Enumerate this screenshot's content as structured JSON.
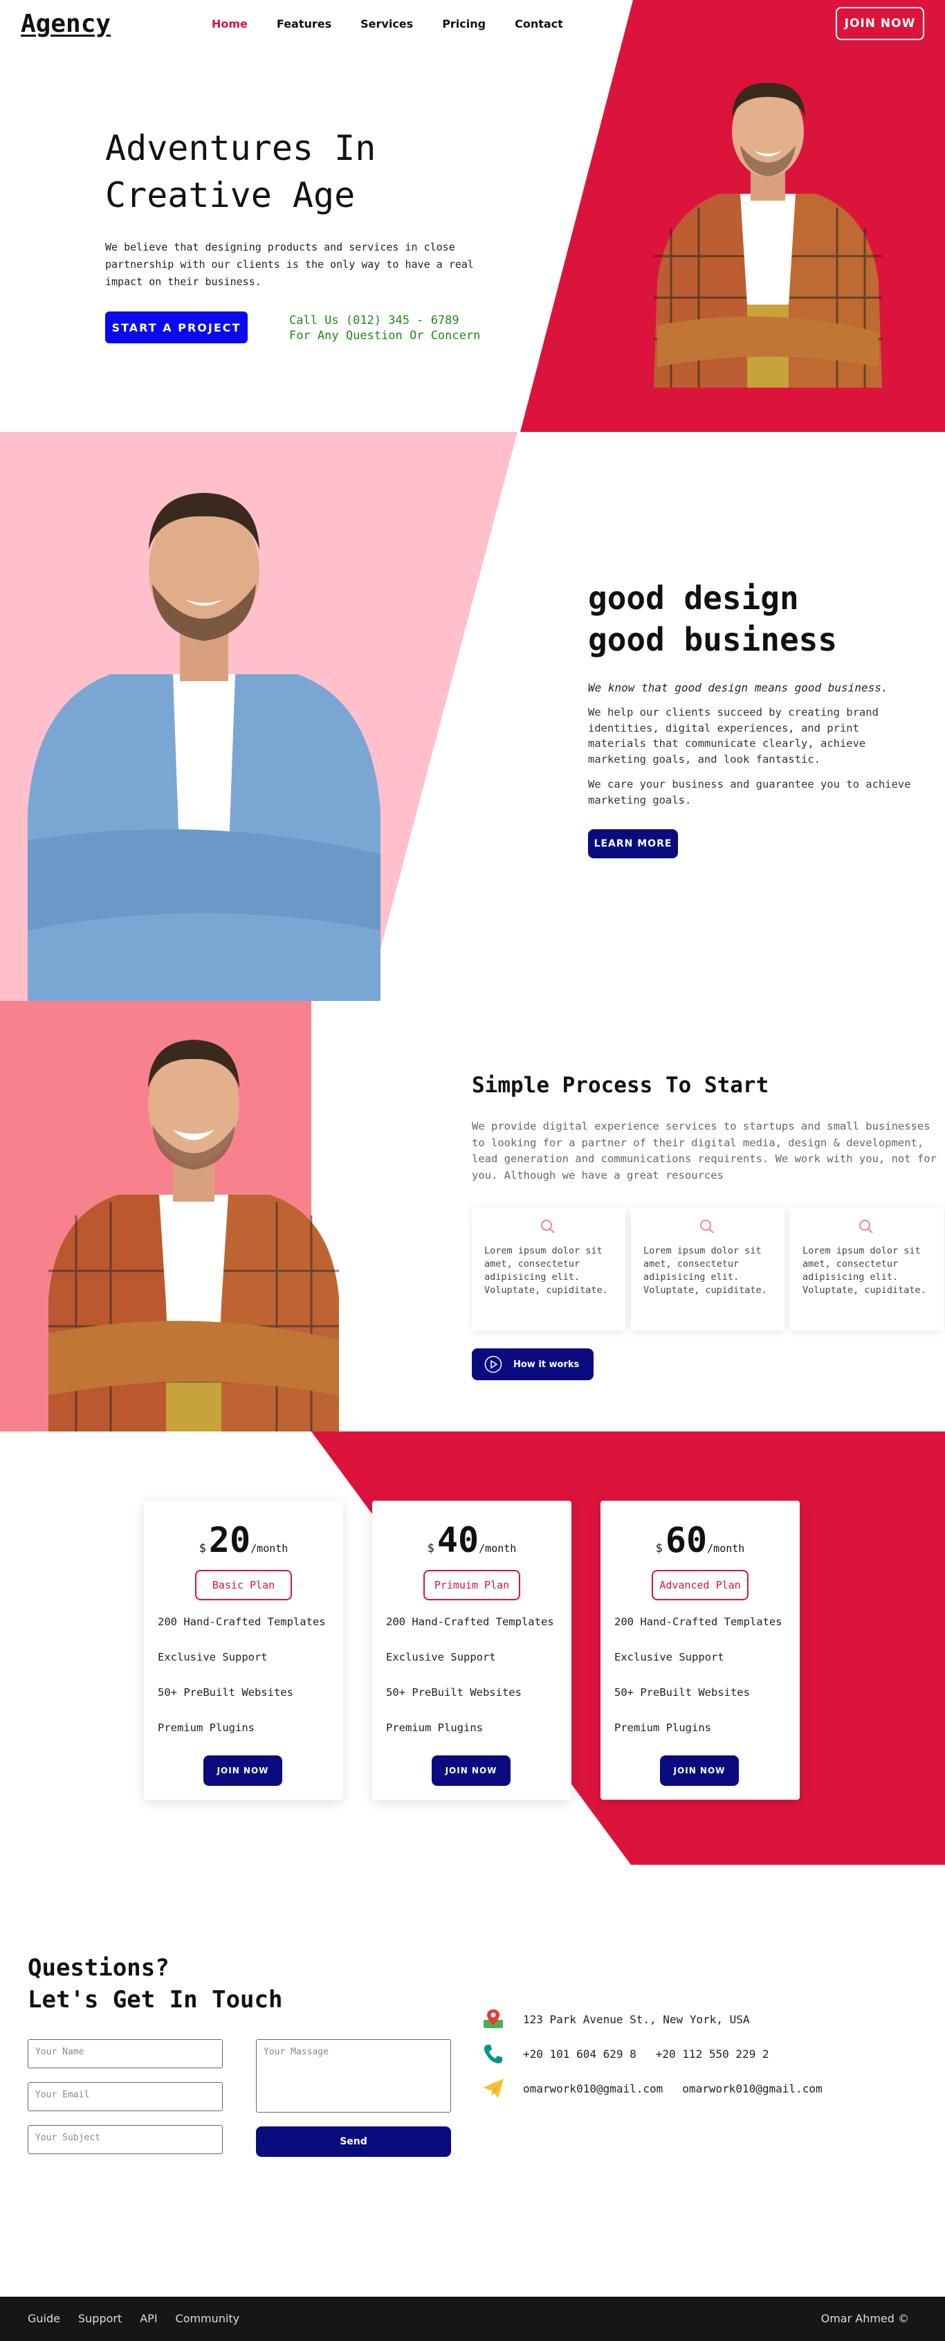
{
  "nav": {
    "logo": "Agency",
    "links": [
      "Home",
      "Features",
      "Services",
      "Pricing",
      "Contact"
    ],
    "join": "JOIN NOW"
  },
  "hero": {
    "title_line1": "Adventures In",
    "title_line2": "Creative Age",
    "text": "We believe that designing products and services in close partnership with our clients is the only way to have a real impact on their business.",
    "cta": "START A PROJECT",
    "call": "Call Us (012) 345 - 6789",
    "question": "For Any Question Or Concern"
  },
  "design": {
    "line1_bold": "good",
    "line1_rest": " design",
    "line2_bold": "good",
    "line2_rest": " business",
    "lead": "We know that good design means good business.",
    "p1": "We help our clients succeed by creating brand identities, digital experiences, and print materials that communicate clearly, achieve marketing goals, and look fantastic.",
    "p2": "We care your business and guarantee you to achieve marketing goals.",
    "cta": "LEARN MORE"
  },
  "process": {
    "title": "Simple Process To Start",
    "text": "We provide digital experience services to startups and small businesses to looking for a partner of their digital media, design & development, lead generation and communications requirents. We work with you, not for you. Although we have a great resources",
    "cards": [
      "Lorem ipsum dolor sit amet, consectetur adipisicing elit. Voluptate, cupiditate.",
      "Lorem ipsum dolor sit amet, consectetur adipisicing elit. Voluptate, cupiditate.",
      "Lorem ipsum dolor sit amet, consectetur adipisicing elit. Voluptate, cupiditate."
    ],
    "cta": "How it works"
  },
  "pricing": {
    "currency": "$",
    "period": "/month",
    "plans": [
      {
        "price": "20",
        "name": "Basic Plan"
      },
      {
        "price": "40",
        "name": "Primuim Plan"
      },
      {
        "price": "60",
        "name": "Advanced Plan"
      }
    ],
    "features": [
      "200 Hand-Crafted Templates",
      "Exclusive Support",
      "50+ PreBuilt Websites",
      "Premium Plugins"
    ],
    "cta": "JOIN NOW"
  },
  "contact": {
    "title_line1": "Questions?",
    "title_line2": "Let's Get In Touch",
    "name_ph": "Your Name",
    "email_ph": "Your Email",
    "subject_ph": "Your Subject",
    "message_ph": "Your Massage",
    "send": "Send",
    "address": "123 Park Avenue St., New York, USA",
    "phone1": "+20 101 604 629 8",
    "phone2": "+20 112 550 229 2",
    "email1": "omarwork010@gmail.com",
    "email2": "omarwork010@gmail.com"
  },
  "footer": {
    "links": [
      "Guide",
      "Support",
      "API",
      "Community"
    ],
    "copyright": "Omar Ahmed ©"
  },
  "colors": {
    "accent_red": "#dc143c",
    "navy": "#0b0b80",
    "blue": "#0a0af0",
    "pink": "#ffc0cb",
    "salmon": "#f7828e",
    "green": "#1a8c1a"
  }
}
